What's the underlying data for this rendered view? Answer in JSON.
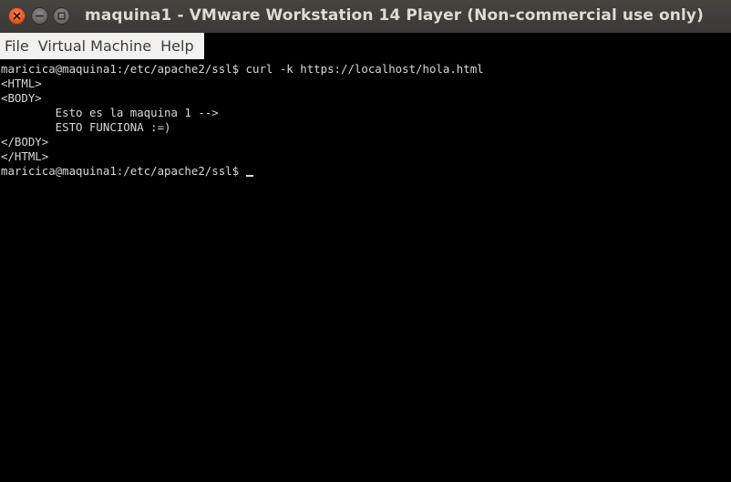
{
  "window": {
    "title": "maquina1 - VMware Workstation 14 Player (Non-commercial use only)",
    "buttons": {
      "close_icon": "close-icon",
      "minimize_icon": "minimize-icon",
      "maximize_icon": "maximize-icon"
    }
  },
  "menubar": {
    "items": [
      {
        "label": "File"
      },
      {
        "label": "Virtual Machine"
      },
      {
        "label": "Help"
      }
    ]
  },
  "terminal": {
    "lines": [
      "maricica@maquina1:/etc/apache2/ssl$ curl -k https://localhost/hola.html",
      "<HTML>",
      "<BODY>",
      "        Esto es la maquina 1 -->",
      "        ESTO FUNCIONA :=)",
      "</BODY>",
      "</HTML>"
    ],
    "prompt": "maricica@maquina1:/etc/apache2/ssl$ "
  },
  "colors": {
    "titlebar": "#3c3b37",
    "close_button": "#e05a2b",
    "menubar": "#f2f1f0",
    "terminal_bg": "#000000",
    "terminal_fg": "#d8d8d8"
  }
}
